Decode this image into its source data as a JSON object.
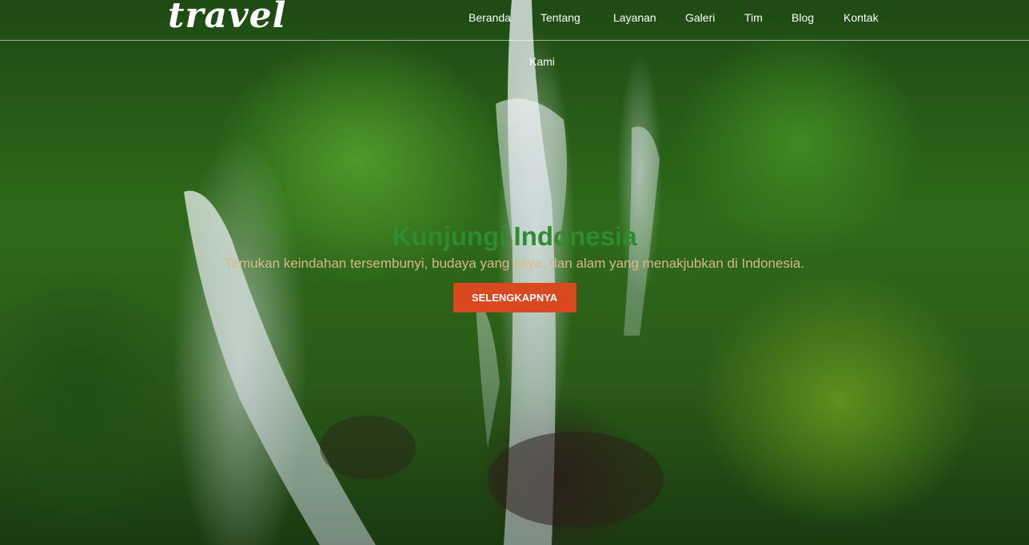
{
  "brand": {
    "logo_text": "travel"
  },
  "nav": {
    "items": [
      {
        "label": "Beranda"
      },
      {
        "label": "Tentang",
        "label_line2": "Kami"
      },
      {
        "label": "Layanan"
      },
      {
        "label": "Galeri"
      },
      {
        "label": "Tim"
      },
      {
        "label": "Blog"
      },
      {
        "label": "Kontak"
      }
    ]
  },
  "hero": {
    "title": "Kunjungi Indonesia",
    "subtitle": "Temukan keindahan tersembunyi, budaya yang kaya, dan alam yang menakjubkan di Indonesia.",
    "button_label": "SELENGKAPNYA"
  },
  "colors": {
    "title": "#2e8b2e",
    "subtitle": "#d9b98a",
    "button": "#d9481f",
    "nav_text": "#ffffff"
  }
}
